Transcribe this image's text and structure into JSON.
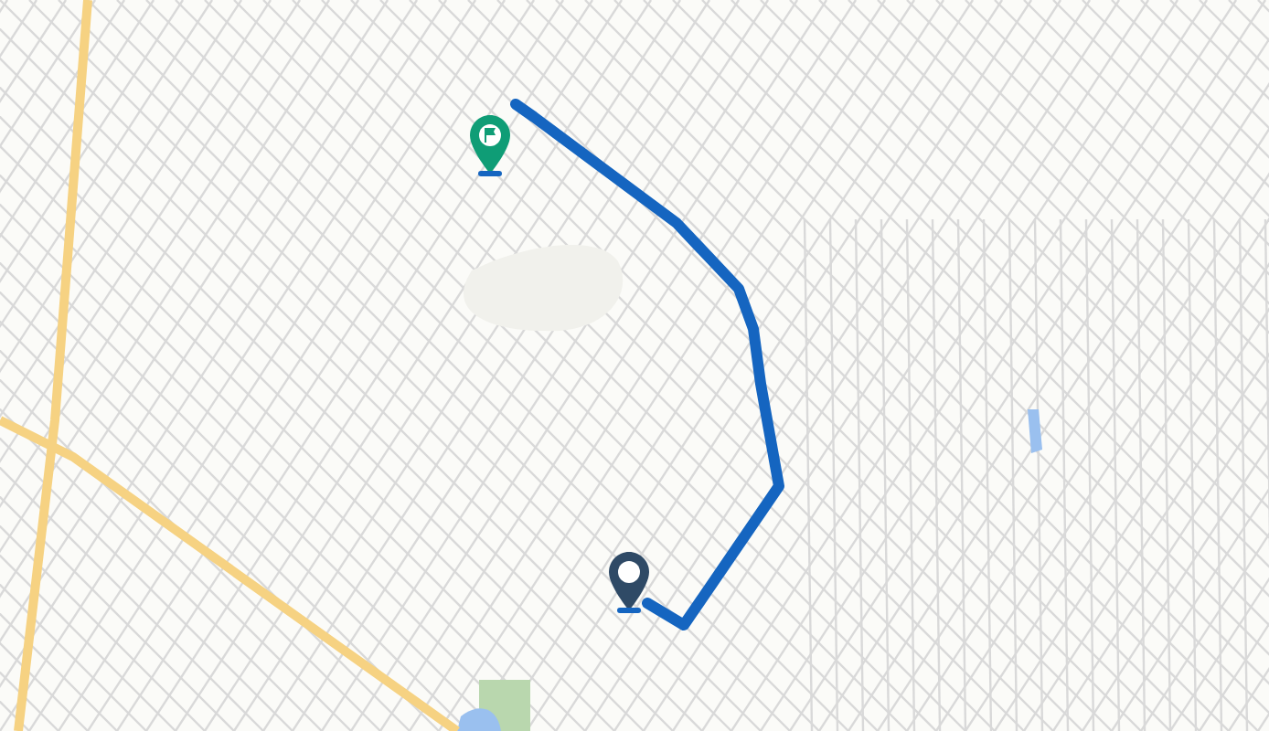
{
  "map": {
    "markers": [
      {
        "kind": "destination"
      },
      {
        "kind": "origin"
      }
    ]
  }
}
